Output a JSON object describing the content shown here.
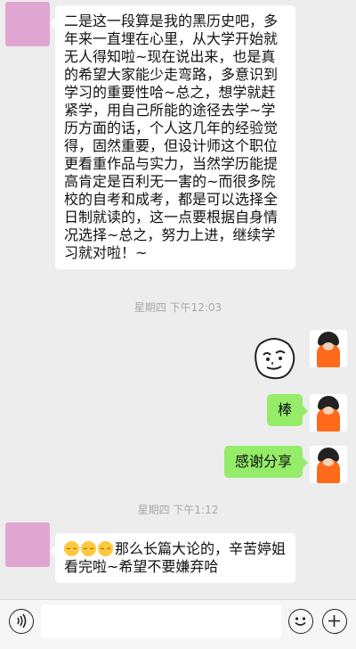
{
  "messages": [
    {
      "side": "left",
      "text": "二是这一段算是我的黑历史吧，多年来一直埋在心里，从大学开始就无人得知啦~现在说出来，也是真的希望大家能少走弯路，多意识到学习的重要性哈~总之，想学就赶紧学，用自己所能的途径去学~学历方面的话，个人这几年的经验觉得，固然重要，但设计师这个职位更看重作品与实力，当然学历能提高肯定是百利无一害的~而很多院校的自考和成考，都是可以选择全日制就读的，这一点要根据自身情况选择~总之，努力上进，继续学习就对啦！~"
    },
    {
      "side": "right",
      "text": "棒"
    },
    {
      "side": "right",
      "text": "感谢分享"
    },
    {
      "side": "left",
      "text": "那么长篇大论的，辛苦婷姐看完啦~希望不要嫌弃哈"
    }
  ],
  "timestamps": [
    "星期四 下午12:03",
    "星期四 下午1:12"
  ],
  "sticker": "doodle-face-sticker",
  "input_bar": {
    "left_icon": "voice-icon",
    "emoji_icon": "emoji-icon",
    "plus_icon": "plus-icon"
  },
  "colors": {
    "background": "#ededed",
    "bubble_left": "#ffffff",
    "bubble_right": "#95ec69",
    "avatar_left": "#e0a6d2",
    "avatar_right_accent": "#ff6a1a"
  }
}
